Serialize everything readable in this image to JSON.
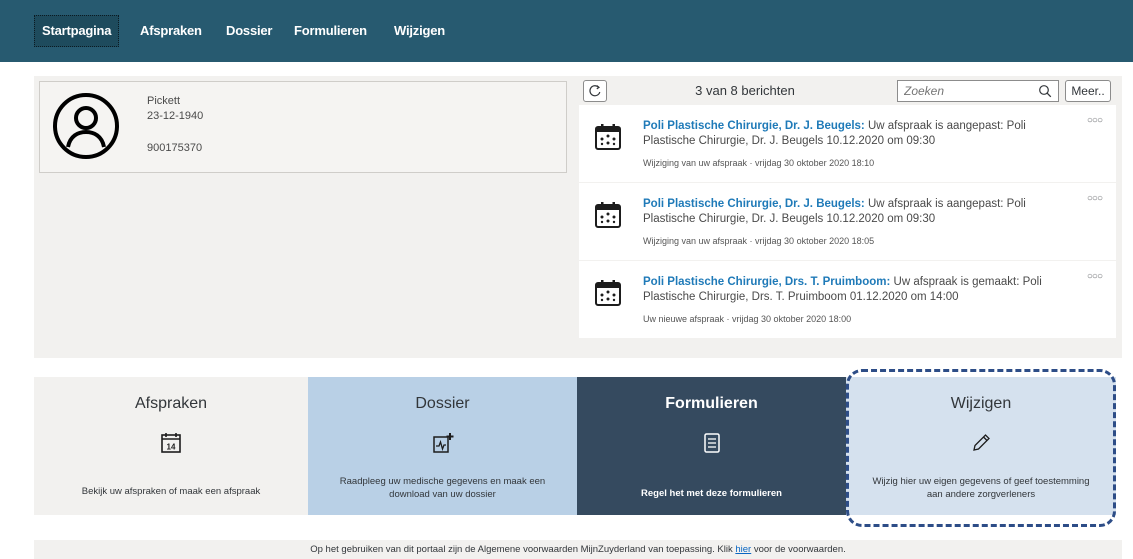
{
  "nav": {
    "items": [
      {
        "label": "Startpagina",
        "active": true
      },
      {
        "label": "Afspraken"
      },
      {
        "label": "Dossier"
      },
      {
        "label": "Formulieren"
      },
      {
        "label": "Wijzigen"
      }
    ]
  },
  "patient": {
    "name": "Pickett",
    "birthdate": "23-12-1940",
    "number": "900175370",
    "avatar_icon": "user-circle-icon"
  },
  "messages": {
    "count_label": "3 van 8 berichten",
    "search_placeholder": "Zoeken",
    "more_label": "Meer..",
    "items": [
      {
        "title": "Poli Plastische Chirurgie, Dr. J. Beugels:",
        "body": " Uw afspraak is aangepast: Poli Plastische Chirurgie, Dr. J. Beugels 10.12.2020 om 09:30",
        "meta": "Wijziging van uw afspraak · vrijdag 30 oktober 2020 18:10",
        "icon": "calendar-icon"
      },
      {
        "title": "Poli Plastische Chirurgie, Dr. J. Beugels:",
        "body": " Uw afspraak is aangepast: Poli Plastische Chirurgie, Dr. J. Beugels 10.12.2020 om 09:30",
        "meta": "Wijziging van uw afspraak · vrijdag 30 oktober 2020 18:05",
        "icon": "calendar-icon"
      },
      {
        "title": "Poli Plastische Chirurgie, Drs. T. Pruimboom:",
        "body": " Uw afspraak is gemaakt: Poli Plastische Chirurgie, Drs. T. Pruimboom 01.12.2020 om 14:00",
        "meta": "Uw nieuwe afspraak · vrijdag 30 oktober 2020 18:00",
        "icon": "calendar-icon"
      }
    ]
  },
  "tiles": [
    {
      "title": "Afspraken",
      "desc": "Bekijk uw afspraken of maak een afspraak",
      "icon": "calendar-14-icon",
      "bg": "#f2f1ef"
    },
    {
      "title": "Dossier",
      "desc": "Raadpleeg uw medische gegevens en maak een download van uw dossier",
      "icon": "medical-record-icon",
      "bg": "#b9d0e6"
    },
    {
      "title": "Formulieren",
      "desc": "Regel het met deze formulieren",
      "icon": "form-icon",
      "bg": "#354a5f"
    },
    {
      "title": "Wijzigen",
      "desc": "Wijzig hier uw eigen gegevens of geef toestemming aan andere zorgverleners",
      "icon": "pencil-icon",
      "bg": "#d5e1ee"
    }
  ],
  "footer": {
    "before": "Op het gebruiken van dit portaal zijn de Algemene voorwaarden MijnZuyderland van toepassing. Klik ",
    "link": "hier",
    "after": " voor de voorwaarden."
  },
  "colors": {
    "nav_bg": "#275a70",
    "link_blue": "#1f7ab8",
    "highlight_border": "#2d4d87"
  }
}
